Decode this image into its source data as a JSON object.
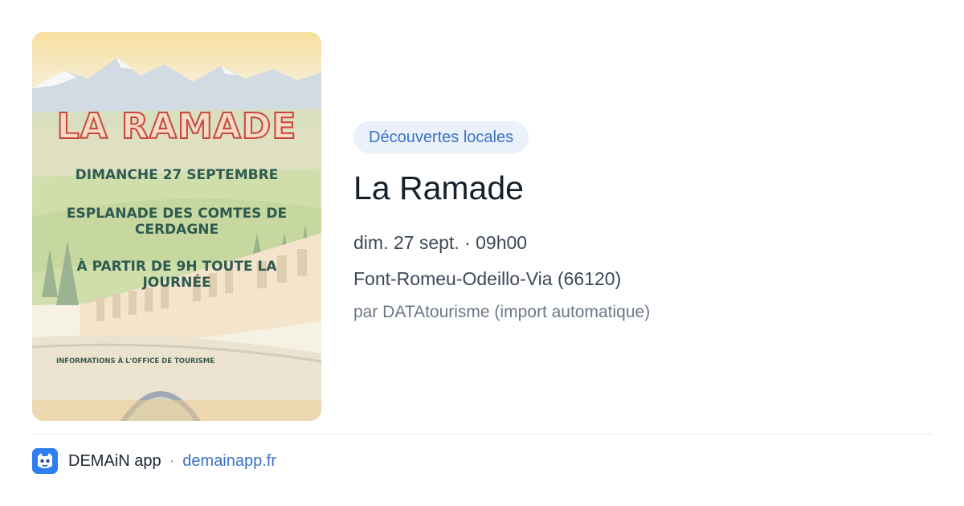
{
  "poster": {
    "title": "LA RAMADE",
    "line1": "DIMANCHE 27 SEPTEMBRE",
    "line2": "ESPLANADE DES COMTES DE CERDAGNE",
    "line3": "À PARTIR DE 9H TOUTE LA JOURNÉE",
    "footer": "INFORMATIONS À L'OFFICE DE TOURISME"
  },
  "event": {
    "category": "Découvertes locales",
    "title": "La Ramade",
    "datetime": "dim. 27 sept. · 09h00",
    "location": "Font-Romeu-Odeillo-Via (66120)",
    "source": "par DATAtourisme (import automatique)"
  },
  "footer": {
    "app_name": "DEMAiN app",
    "separator": "·",
    "domain": "demainapp.fr"
  },
  "colors": {
    "badge_bg": "#eaf1fb",
    "badge_text": "#3a73c4",
    "link": "#3a73c4",
    "app_icon": "#2f7ff0"
  },
  "icons": {
    "app": "demain-app-icon"
  }
}
